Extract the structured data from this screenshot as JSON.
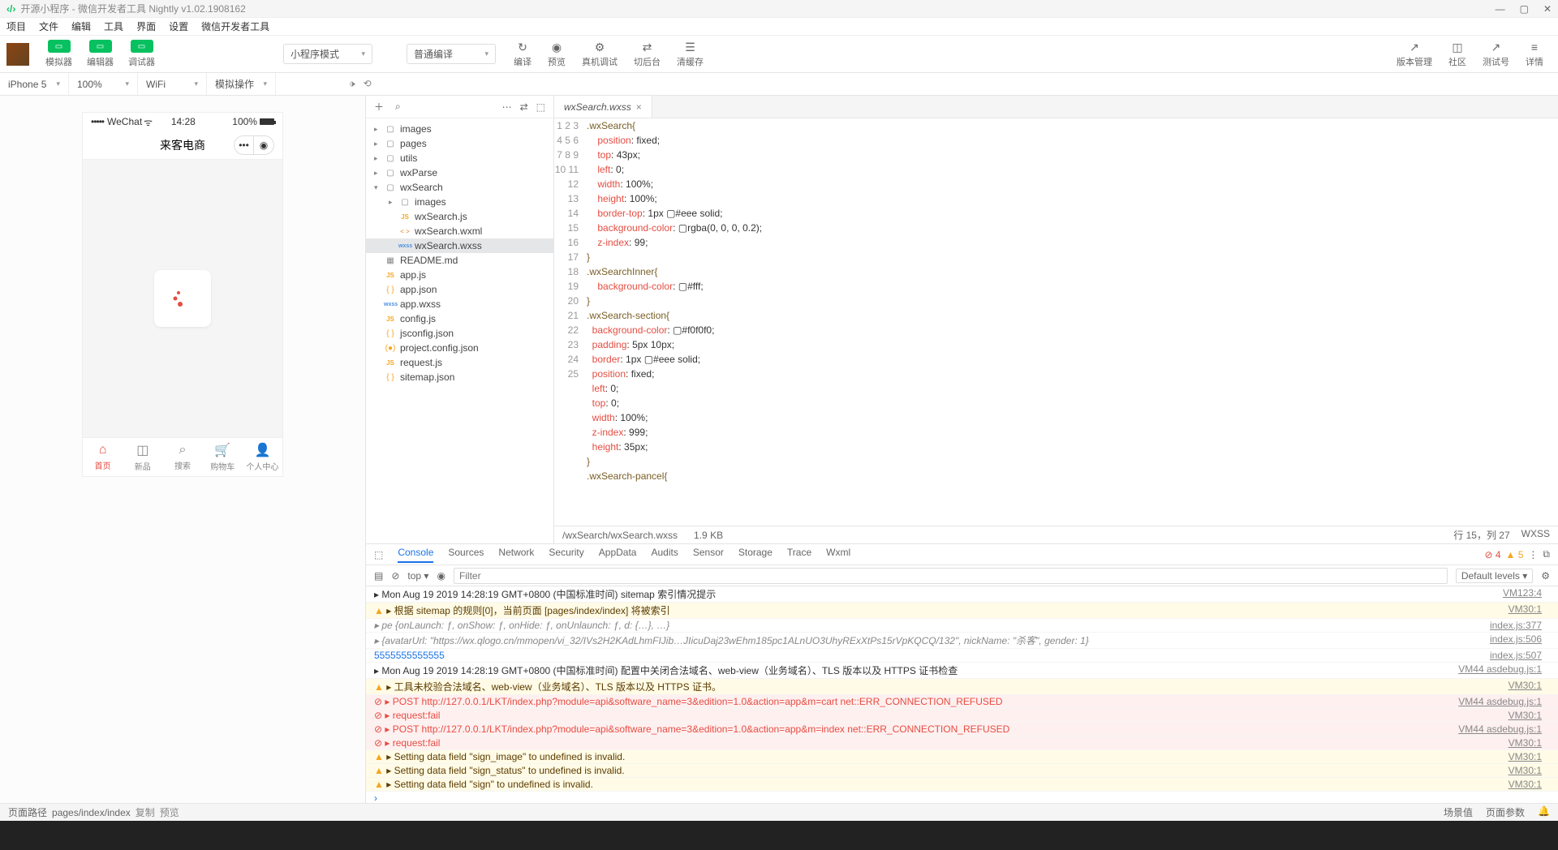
{
  "window": {
    "title": "开源小程序 - 微信开发者工具 Nightly v1.02.1908162"
  },
  "menu": [
    "项目",
    "文件",
    "编辑",
    "工具",
    "界面",
    "设置",
    "微信开发者工具"
  ],
  "toolbar": {
    "modes": [
      {
        "label": "模拟器"
      },
      {
        "label": "编辑器"
      },
      {
        "label": "调试器"
      }
    ],
    "program_mode": "小程序模式",
    "compile_mode": "普通编译",
    "actions": [
      {
        "icon": "↻",
        "label": "编译"
      },
      {
        "icon": "◉",
        "label": "预览"
      },
      {
        "icon": "⚙",
        "label": "真机调试"
      },
      {
        "icon": "⇄",
        "label": "切后台"
      },
      {
        "icon": "☰",
        "label": "清缓存"
      }
    ],
    "right_actions": [
      {
        "icon": "↗",
        "label": "版本管理"
      },
      {
        "icon": "◫",
        "label": "社区"
      },
      {
        "icon": "↗",
        "label": "测试号"
      },
      {
        "icon": "≡",
        "label": "详情"
      }
    ]
  },
  "device": {
    "model": "iPhone 5",
    "zoom": "100%",
    "network": "WiFi",
    "mock": "模拟操作"
  },
  "phone": {
    "carrier": "WeChat",
    "time": "14:28",
    "battery": "100%",
    "title": "来客电商",
    "tabs": [
      {
        "icon": "⌂",
        "label": "首页",
        "active": true
      },
      {
        "icon": "◫",
        "label": "新品"
      },
      {
        "icon": "⌕",
        "label": "搜索"
      },
      {
        "icon": "🛒",
        "label": "购物车"
      },
      {
        "icon": "👤",
        "label": "个人中心"
      }
    ]
  },
  "files": [
    {
      "type": "folder",
      "name": "images",
      "depth": 0,
      "expanded": false
    },
    {
      "type": "folder",
      "name": "pages",
      "depth": 0,
      "expanded": false
    },
    {
      "type": "folder",
      "name": "utils",
      "depth": 0,
      "expanded": false
    },
    {
      "type": "folder",
      "name": "wxParse",
      "depth": 0,
      "expanded": false
    },
    {
      "type": "folder",
      "name": "wxSearch",
      "depth": 0,
      "expanded": true
    },
    {
      "type": "folder",
      "name": "images",
      "depth": 1,
      "expanded": false
    },
    {
      "type": "js",
      "name": "wxSearch.js",
      "depth": 1
    },
    {
      "type": "wxml",
      "name": "wxSearch.wxml",
      "depth": 1
    },
    {
      "type": "wxss",
      "name": "wxSearch.wxss",
      "depth": 1,
      "selected": true
    },
    {
      "type": "md",
      "name": "README.md",
      "depth": 0
    },
    {
      "type": "js",
      "name": "app.js",
      "depth": 0
    },
    {
      "type": "json",
      "name": "app.json",
      "depth": 0
    },
    {
      "type": "wxss",
      "name": "app.wxss",
      "depth": 0
    },
    {
      "type": "js",
      "name": "config.js",
      "depth": 0
    },
    {
      "type": "json",
      "name": "jsconfig.json",
      "depth": 0
    },
    {
      "type": "json",
      "name": "project.config.json",
      "depth": 0,
      "ficn": "(●)"
    },
    {
      "type": "js",
      "name": "request.js",
      "depth": 0
    },
    {
      "type": "json",
      "name": "sitemap.json",
      "depth": 0
    }
  ],
  "editor": {
    "tab": "wxSearch.wxss",
    "lines": [
      {
        "n": 1,
        "t": ".wxSearch{",
        "cls": "sel"
      },
      {
        "n": 2,
        "t": "    position: fixed;",
        "prop": "position",
        "val": "fixed"
      },
      {
        "n": 3,
        "t": "    top: 43px;",
        "prop": "top",
        "val": "43px"
      },
      {
        "n": 4,
        "t": "    left: 0;",
        "prop": "left",
        "val": "0"
      },
      {
        "n": 5,
        "t": "    width: 100%;",
        "prop": "width",
        "val": "100%"
      },
      {
        "n": 6,
        "t": "    height: 100%;",
        "prop": "height",
        "val": "100%"
      },
      {
        "n": 7,
        "t": "    border-top: 1px ▢#eee solid;",
        "prop": "border-top",
        "val": "1px ▢#eee solid"
      },
      {
        "n": 8,
        "t": "    background-color: ▢rgba(0, 0, 0, 0.2);",
        "prop": "background-color",
        "val": "▢rgba(0, 0, 0, 0.2)"
      },
      {
        "n": 9,
        "t": "    z-index: 99",
        "prop": "z-index",
        "val": "99"
      },
      {
        "n": 10,
        "t": "}",
        "cls": "sel"
      },
      {
        "n": 11,
        "t": ".wxSearchInner{",
        "cls": "sel"
      },
      {
        "n": 12,
        "t": "    background-color: ▢#fff;",
        "prop": "background-color",
        "val": "▢#fff"
      },
      {
        "n": 13,
        "t": "}",
        "cls": "sel"
      },
      {
        "n": 14,
        "t": ".wxSearch-section{",
        "cls": "sel"
      },
      {
        "n": 15,
        "t": "  background-color:▢#f0f0f0;",
        "prop": "background-color",
        "val": "▢#f0f0f0"
      },
      {
        "n": 16,
        "t": "  padding:5px 10px;",
        "prop": "padding",
        "val": "5px 10px"
      },
      {
        "n": 17,
        "t": "  border:1px ▢#eee solid;",
        "prop": "border",
        "val": "1px ▢#eee solid"
      },
      {
        "n": 18,
        "t": "  position:fixed;",
        "prop": "position",
        "val": "fixed"
      },
      {
        "n": 19,
        "t": "  left:0;",
        "prop": "left",
        "val": "0"
      },
      {
        "n": 20,
        "t": "  top:0;",
        "prop": "top",
        "val": "0"
      },
      {
        "n": 21,
        "t": "  width:100%;",
        "prop": "width",
        "val": "100%"
      },
      {
        "n": 22,
        "t": "  z-index:999;",
        "prop": "z-index",
        "val": "999"
      },
      {
        "n": 23,
        "t": "  height:35px;",
        "prop": "height",
        "val": "35px"
      },
      {
        "n": 24,
        "t": "}",
        "cls": "sel"
      },
      {
        "n": 25,
        "t": ".wxSearch-pancel{",
        "cls": "sel"
      }
    ],
    "status_path": "/wxSearch/wxSearch.wxss",
    "status_size": "1.9 KB",
    "status_pos": "行 15，列 27",
    "status_lang": "WXSS"
  },
  "devtools": {
    "tabs": [
      "Console",
      "Sources",
      "Network",
      "Security",
      "AppData",
      "Audits",
      "Sensor",
      "Storage",
      "Trace",
      "Wxml"
    ],
    "active_tab": "Console",
    "filter_placeholder": "Filter",
    "levels": "Default levels ▾",
    "context": "top",
    "errors": "4",
    "warnings": "5",
    "logs": [
      {
        "type": "msg",
        "text": "▸ Mon Aug 19 2019 14:28:19 GMT+0800 (中国标准时间) sitemap 索引情况提示",
        "src": "VM123:4"
      },
      {
        "type": "warn",
        "text": "▸ 根据 sitemap 的规则[0]，当前页面 [pages/index/index] 将被索引",
        "src": "VM30:1"
      },
      {
        "type": "debug",
        "text": "▸ pe {onLaunch: ƒ, onShow: ƒ, onHide: ƒ, onUnlaunch: ƒ, d: {…}, …}",
        "src": "index.js:377"
      },
      {
        "type": "debug",
        "text": "▸ {avatarUrl: \"https://wx.qlogo.cn/mmopen/vi_32/IVs2H2KAdLhmFIJib…JIicuDaj23wEhm185pc1ALnUO3UhyRExXtPs15rVpKQCQ/132\", nickName: \"杀客\", gender: 1}",
        "src": "index.js:506"
      },
      {
        "type": "info",
        "text": "5555555555555",
        "src": "index.js:507"
      },
      {
        "type": "msg",
        "text": "▸ Mon Aug 19 2019 14:28:19 GMT+0800 (中国标准时间) 配置中关闭合法域名、web-view（业务域名）、TLS 版本以及 HTTPS 证书检查",
        "src": "VM44 asdebug.js:1"
      },
      {
        "type": "warn",
        "text": "▸ 工具未校验合法域名、web-view（业务域名）、TLS 版本以及 HTTPS 证书。",
        "src": "VM30:1"
      },
      {
        "type": "err",
        "text": "▸ POST http://127.0.0.1/LKT/index.php?module=api&software_name=3&edition=1.0&action=app&m=cart net::ERR_CONNECTION_REFUSED",
        "src": "VM44 asdebug.js:1",
        "link": true
      },
      {
        "type": "err",
        "text": "▸ request:fail",
        "src": "VM30:1"
      },
      {
        "type": "err",
        "text": "▸ POST http://127.0.0.1/LKT/index.php?module=api&software_name=3&edition=1.0&action=app&m=index net::ERR_CONNECTION_REFUSED",
        "src": "VM44 asdebug.js:1",
        "link": true
      },
      {
        "type": "err",
        "text": "▸ request:fail",
        "src": "VM30:1"
      },
      {
        "type": "warn",
        "text": "▸ Setting data field \"sign_image\" to undefined is invalid.",
        "src": "VM30:1"
      },
      {
        "type": "warn",
        "text": "▸ Setting data field \"sign_status\" to undefined is invalid.",
        "src": "VM30:1"
      },
      {
        "type": "warn",
        "text": "▸ Setting data field \"sign\" to undefined is invalid.",
        "src": "VM30:1"
      }
    ]
  },
  "statusbar": {
    "page_path_label": "页面路径",
    "page_path": "pages/index/index",
    "copy": "复制",
    "preview": "预览",
    "scene": "场景值",
    "page_params": "页面参数"
  }
}
